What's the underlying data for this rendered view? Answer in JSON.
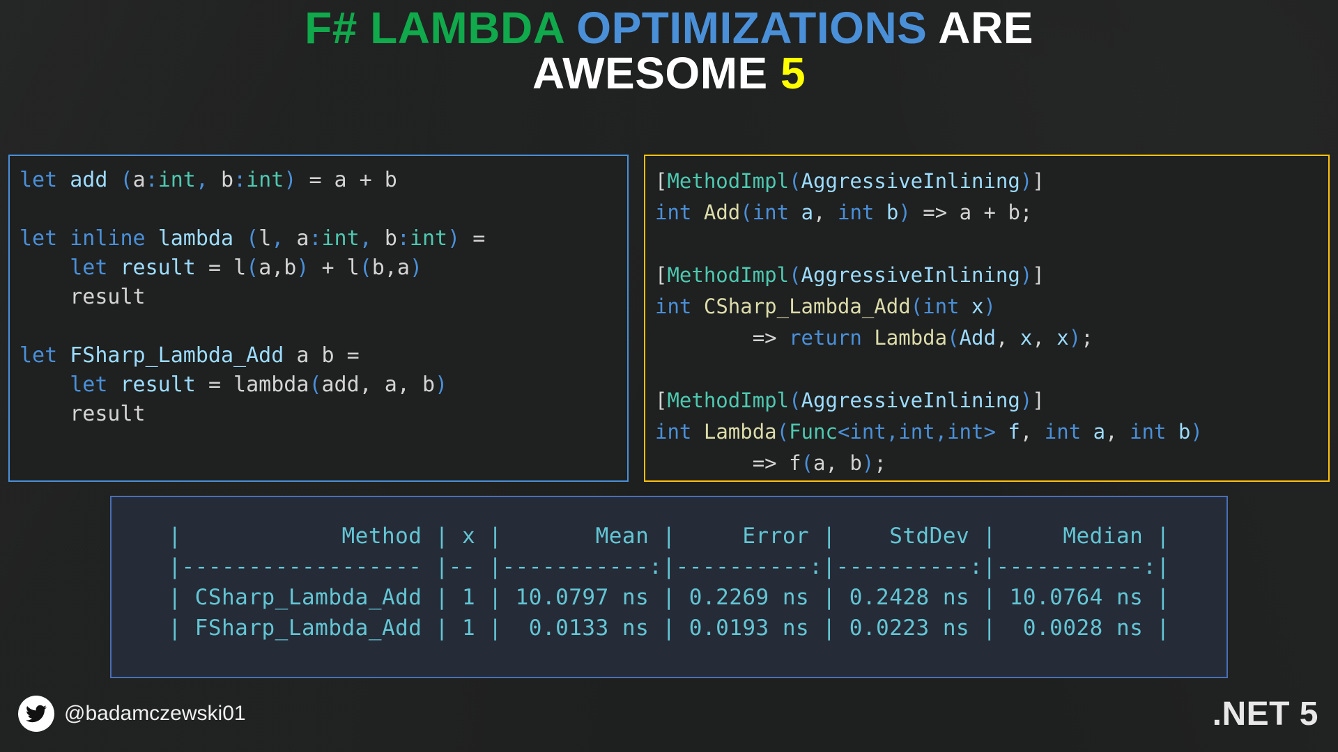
{
  "title": {
    "segments": [
      {
        "text": "F# LAMBDA ",
        "color_name": "green",
        "color": "#10a94b"
      },
      {
        "text": "OPTIMIZATIONS ",
        "color_name": "blue",
        "color": "#4a90d9"
      },
      {
        "text": "ARE",
        "color_name": "white",
        "color": "#ffffff"
      }
    ],
    "segments_line2": [
      {
        "text": "AWESOME ",
        "color_name": "white",
        "color": "#ffffff"
      },
      {
        "text": "5",
        "color_name": "yellow",
        "color": "#ffff00"
      }
    ],
    "line1_plain": "F# LAMBDA OPTIMIZATIONS ARE",
    "line2_plain": "AWESOME 5"
  },
  "panels": {
    "fsharp": {
      "language": "F#",
      "border_color": "#4a90d9",
      "code_plain": "let add (a:int, b:int) = a + b\n\nlet inline lambda (l, a:int, b:int) =\n    let result = l(a,b) + l(b,a)\n    result\n\nlet FSharp_Lambda_Add a b =\n    let result = lambda(add, a, b)\n    result"
    },
    "csharp": {
      "language": "C#",
      "border_color": "#ffc20e",
      "code_plain": "[MethodImpl(AggressiveInlining)]\nint Add(int a, int b) => a + b;\n\n[MethodImpl(AggressiveInlining)]\nint CSharp_Lambda_Add(int x)\n        => return Lambda(Add, x, x);\n\n[MethodImpl(AggressiveInlining)]\nint Lambda(Func<int,int,int> f, int a, int b)\n        => f(a, b);"
    }
  },
  "benchmark": {
    "border_color": "#4a6fb5",
    "background": "#262b38",
    "text_color": "#63c6d4",
    "columns": [
      "Method",
      "x",
      "Mean",
      "Error",
      "StdDev",
      "Median"
    ],
    "rows": [
      {
        "Method": "CSharp_Lambda_Add",
        "x": "1",
        "Mean": "10.0797 ns",
        "Error": "0.2269 ns",
        "StdDev": "0.2428 ns",
        "Median": "10.0764 ns"
      },
      {
        "Method": "FSharp_Lambda_Add",
        "x": "1",
        "Mean": "0.0133 ns",
        "Error": "0.0193 ns",
        "StdDev": "0.0223 ns",
        "Median": "0.0028 ns"
      }
    ],
    "ascii": "|            Method | x |       Mean |     Error |    StdDev |     Median |\n|------------------ |-- |-----------:|----------:|----------:|-----------:|\n| CSharp_Lambda_Add | 1 | 10.0797 ns | 0.2269 ns | 0.2428 ns | 10.0764 ns |\n| FSharp_Lambda_Add | 1 |  0.0133 ns | 0.0193 ns | 0.0223 ns |  0.0028 ns |"
  },
  "footer": {
    "twitter_icon": "twitter-bird-icon",
    "handle": "@badamczewski01",
    "dotnet_version": ".NET 5"
  }
}
